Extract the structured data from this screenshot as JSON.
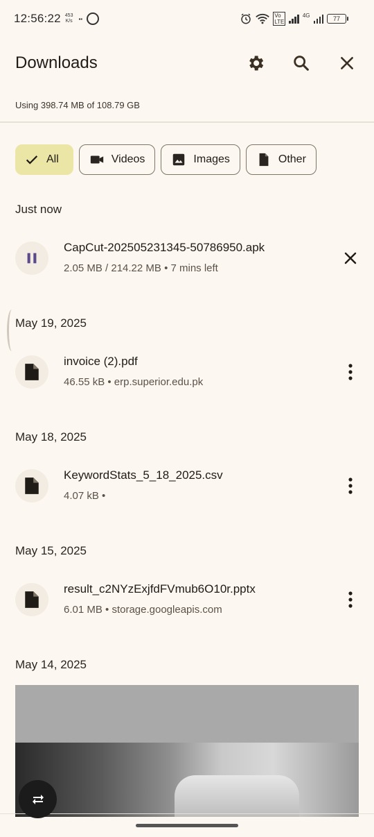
{
  "status_bar": {
    "time": "12:56:22",
    "net_speed_value": "453",
    "net_speed_unit": "K/s",
    "battery": "77",
    "lte": "4G"
  },
  "app_bar": {
    "title": "Downloads",
    "actions": [
      "gear-icon",
      "search-icon",
      "close-icon"
    ]
  },
  "storage": {
    "text": "Using 398.74 MB of 108.79 GB"
  },
  "filters": [
    {
      "label": "All",
      "icon": "check-icon",
      "selected": true
    },
    {
      "label": "Videos",
      "icon": "video-icon",
      "selected": false
    },
    {
      "label": "Images",
      "icon": "image-icon",
      "selected": false
    },
    {
      "label": "Other",
      "icon": "file-icon",
      "selected": false
    }
  ],
  "sections": [
    {
      "label": "Just now",
      "items": [
        {
          "title": "CapCut-202505231345-50786950.apk",
          "subtitle": "2.05 MB / 214.22 MB • 7 mins left",
          "icon": "pause-icon",
          "action": "close-icon"
        }
      ]
    },
    {
      "label": "May 19, 2025",
      "items": [
        {
          "title": "invoice (2).pdf",
          "subtitle": "46.55 kB • erp.superior.edu.pk",
          "icon": "file-icon",
          "action": "more-vert-icon"
        }
      ]
    },
    {
      "label": "May 18, 2025",
      "items": [
        {
          "title": "KeywordStats_5_18_2025.csv",
          "subtitle": "4.07 kB •",
          "icon": "file-icon",
          "action": "more-vert-icon"
        }
      ]
    },
    {
      "label": "May 15, 2025",
      "items": [
        {
          "title": "result_c2NYzExjfdFVmub6O10r.pptx",
          "subtitle": "6.01 MB • storage.googleapis.com",
          "icon": "file-icon",
          "action": "more-vert-icon"
        }
      ]
    },
    {
      "label": "May 14, 2025",
      "items": []
    }
  ],
  "colors": {
    "background": "#fdf7f1",
    "chip_selected": "#ece6a6",
    "pause_accent": "#5b4a8a",
    "fab": "#1b1b1b"
  },
  "fab": {
    "icon": "repeat-icon"
  }
}
